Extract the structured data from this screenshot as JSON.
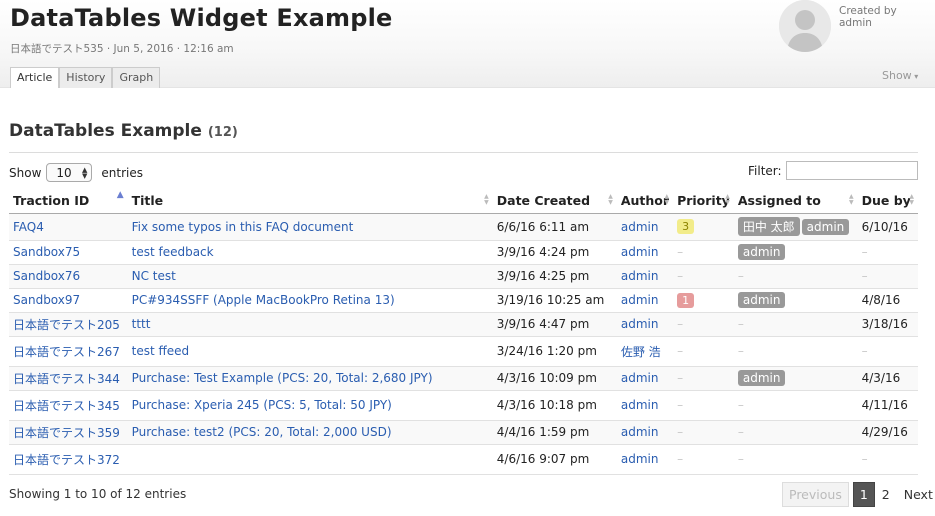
{
  "page": {
    "title": "DataTables Widget Example",
    "meta": "日本語でテスト535 · Jun 5, 2016 · 12:16 am",
    "tabs": [
      {
        "label": "Article",
        "active": true
      },
      {
        "label": "History",
        "active": false
      },
      {
        "label": "Graph",
        "active": false
      }
    ],
    "created_by_label": "Created by",
    "created_by_user": "admin",
    "show_label": "Show",
    "avatar_icon": "user-silhouette-icon"
  },
  "section": {
    "title": "DataTables Example",
    "count": "(12)"
  },
  "controls": {
    "show_label": "Show",
    "length_value": "10",
    "entries_label": "entries",
    "filter_label": "Filter:",
    "filter_value": ""
  },
  "table": {
    "columns": [
      "Traction ID",
      "Title",
      "Date Created",
      "Author",
      "Priority",
      "Assigned to",
      "Due by"
    ],
    "sorted_column": "Traction ID",
    "rows": [
      {
        "id": "FAQ4",
        "title": "Fix some typos in this FAQ document",
        "date": "6/6/16 6:11 am",
        "author": "admin",
        "priority": "3",
        "priority_color": "#f2ec8a",
        "assigned": [
          "田中 太郎",
          "admin"
        ],
        "due": "6/10/16"
      },
      {
        "id": "Sandbox75",
        "title": "test feedback",
        "date": "3/9/16 4:24 pm",
        "author": "admin",
        "priority": "–",
        "priority_color": "",
        "assigned": [
          "admin"
        ],
        "due": "–"
      },
      {
        "id": "Sandbox76",
        "title": "NC test",
        "date": "3/9/16 4:25 pm",
        "author": "admin",
        "priority": "–",
        "priority_color": "",
        "assigned": [],
        "due": "–"
      },
      {
        "id": "Sandbox97",
        "title": "PC#934SSFF (Apple MacBookPro Retina 13)",
        "date": "3/19/16 10:25 am",
        "author": "admin",
        "priority": "1",
        "priority_color": "#e69c9c",
        "assigned": [
          "admin"
        ],
        "due": "4/8/16"
      },
      {
        "id": "日本語でテスト205",
        "title": "tttt",
        "date": "3/9/16 4:47 pm",
        "author": "admin",
        "priority": "–",
        "priority_color": "",
        "assigned": [],
        "due": "3/18/16"
      },
      {
        "id": "日本語でテスト267",
        "title": "test ffeed",
        "date": "3/24/16 1:20 pm",
        "author": "佐野 浩",
        "priority": "–",
        "priority_color": "",
        "assigned": [],
        "due": "–"
      },
      {
        "id": "日本語でテスト344",
        "title": "Purchase: Test Example (PCS: 20, Total: 2,680 JPY)",
        "date": "4/3/16 10:09 pm",
        "author": "admin",
        "priority": "–",
        "priority_color": "",
        "assigned": [
          "admin"
        ],
        "due": "4/3/16"
      },
      {
        "id": "日本語でテスト345",
        "title": "Purchase: Xperia 245 (PCS: 5, Total: 50 JPY)",
        "date": "4/3/16 10:18 pm",
        "author": "admin",
        "priority": "–",
        "priority_color": "",
        "assigned": [],
        "due": "4/11/16"
      },
      {
        "id": "日本語でテスト359",
        "title": "Purchase: test2 (PCS: 20, Total: 2,000 USD)",
        "date": "4/4/16 1:59 pm",
        "author": "admin",
        "priority": "–",
        "priority_color": "",
        "assigned": [],
        "due": "4/29/16"
      },
      {
        "id": "日本語でテスト372",
        "title": "",
        "date": "4/6/16 9:07 pm",
        "author": "admin",
        "priority": "–",
        "priority_color": "",
        "assigned": [],
        "due": "–"
      }
    ]
  },
  "footer": {
    "info": "Showing 1 to 10 of 12 entries",
    "previous": "Previous",
    "pages": [
      "1",
      "2"
    ],
    "current_page": "1",
    "next": "Next"
  }
}
